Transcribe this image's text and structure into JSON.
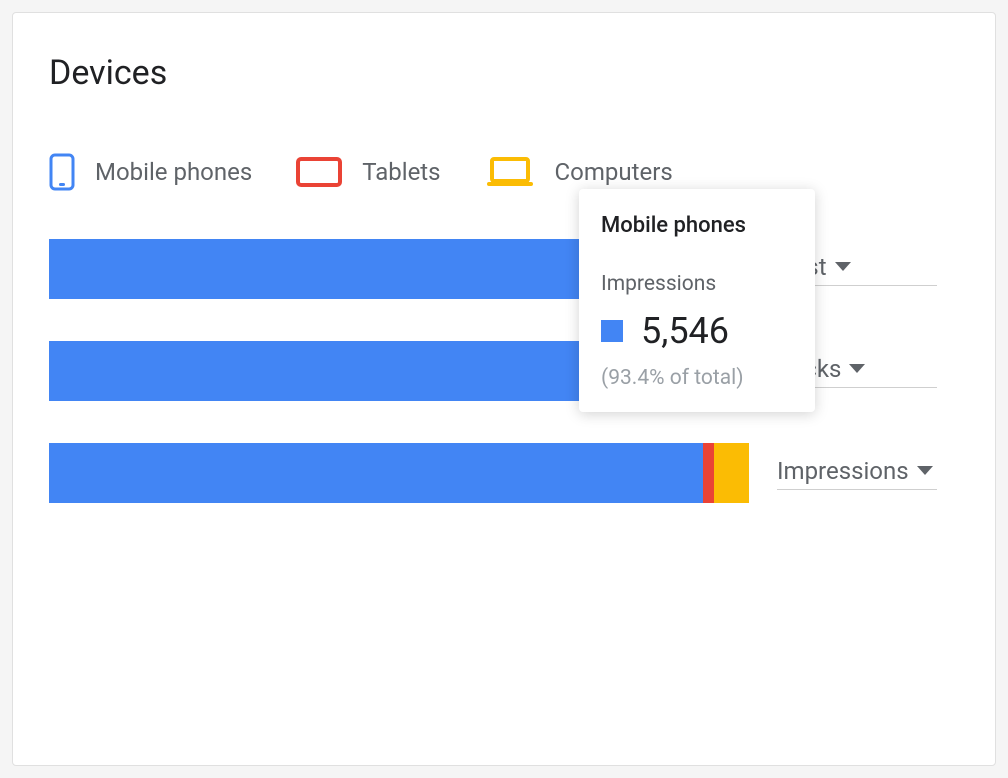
{
  "title": "Devices",
  "legend": [
    {
      "label": "Mobile phones"
    },
    {
      "label": "Tablets"
    },
    {
      "label": "Computers"
    }
  ],
  "rows": [
    {
      "metric": "Cost",
      "blue_pct": 78.0,
      "red_pct": 0.0,
      "amber_pct": 0.0
    },
    {
      "metric": "Clicks",
      "blue_pct": 78.0,
      "red_pct": 0.0,
      "amber_pct": 0.0
    },
    {
      "metric": "Impressions",
      "blue_pct": 93.4,
      "red_pct": 1.6,
      "amber_pct": 5.0
    }
  ],
  "tooltip": {
    "title": "Mobile phones",
    "metric": "Impressions",
    "value": "5,546",
    "pct_text": "(93.4% of total)"
  },
  "colors": {
    "blue": "#4285f4",
    "red": "#ea4335",
    "amber": "#fbbc04"
  },
  "chart_data": {
    "type": "bar",
    "orientation": "horizontal",
    "stacked": true,
    "categories": [
      "Cost",
      "Clicks",
      "Impressions"
    ],
    "series": [
      {
        "name": "Mobile phones",
        "color": "#4285f4",
        "pct_of_total": [
          null,
          null,
          93.4
        ],
        "values": [
          null,
          null,
          5546
        ]
      },
      {
        "name": "Tablets",
        "color": "#ea4335",
        "pct_of_total": [
          null,
          null,
          1.6
        ],
        "values": [
          null,
          null,
          null
        ]
      },
      {
        "name": "Computers",
        "color": "#fbbc04",
        "pct_of_total": [
          null,
          null,
          5.0
        ],
        "values": [
          null,
          null,
          null
        ]
      }
    ],
    "annotations": [
      {
        "series": "Mobile phones",
        "category": "Impressions",
        "value": 5546,
        "pct_of_total": 93.4
      }
    ],
    "title": "Devices",
    "xlabel": "",
    "ylabel": "",
    "legend_position": "top"
  }
}
